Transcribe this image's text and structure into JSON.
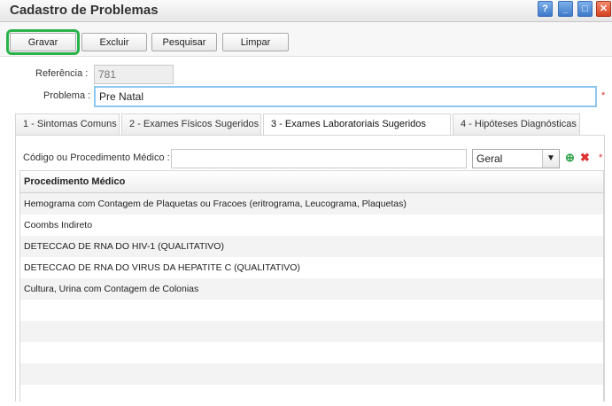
{
  "window": {
    "title": "Cadastro de Problemas",
    "buttons": [
      "?",
      "_",
      "□",
      "✕"
    ]
  },
  "toolbar": {
    "save_label": "Gravar",
    "delete_label": "Excluir",
    "search_label": "Pesquisar",
    "clear_label": "Limpar"
  },
  "form": {
    "referencia_label": "Referência :",
    "referencia_value": "781",
    "problema_label": "Problema :",
    "problema_value": "Pre Natal",
    "required_mark": "*"
  },
  "tabs": [
    {
      "label": "1 - Sintomas Comuns"
    },
    {
      "label": "2 - Exames Físicos Sugeridos"
    },
    {
      "label": "3 - Exames Laboratoriais Sugeridos"
    },
    {
      "label": "4 - Hipóteses Diagnósticas"
    }
  ],
  "procedure": {
    "code_label": "Código ou Procedimento Médico :",
    "code_value": "",
    "scope_value": "Geral",
    "add_icon": "add-icon",
    "remove_icon": "remove-icon"
  },
  "table": {
    "header": "Procedimento Médico",
    "rows": [
      "Hemograma com Contagem de Plaquetas ou Fracoes (eritrograma, Leucograma, Plaquetas)",
      "Coombs Indireto",
      "DETECCAO DE RNA DO HIV-1 (QUALITATIVO)",
      "DETECCAO DE RNA DO VIRUS DA HEPATITE C (QUALITATIVO)",
      "Cultura, Urina com Contagem de Colonias",
      "",
      "",
      "",
      "",
      ""
    ]
  }
}
